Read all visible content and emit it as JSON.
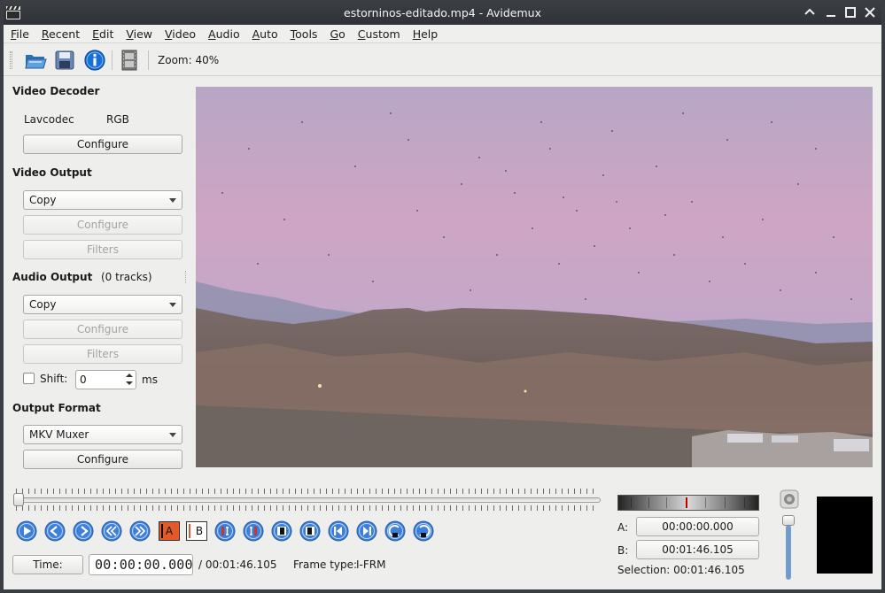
{
  "window": {
    "title": "estorninos-editado.mp4 - Avidemux"
  },
  "menu": [
    "File",
    "Recent",
    "Edit",
    "View",
    "Video",
    "Audio",
    "Auto",
    "Tools",
    "Go",
    "Custom",
    "Help"
  ],
  "toolbar": {
    "zoom": "Zoom: 40%",
    "icons": [
      "open-icon",
      "save-icon",
      "info-icon",
      "filmstrip-icon"
    ]
  },
  "panel": {
    "video_decoder": {
      "heading": "Video Decoder",
      "codec": "Lavcodec",
      "format": "RGB",
      "configure": "Configure"
    },
    "video_output": {
      "heading": "Video Output",
      "selected": "Copy",
      "configure": "Configure",
      "filters": "Filters"
    },
    "audio_output": {
      "heading": "Audio Output",
      "tracks": "(0 tracks)",
      "selected": "Copy",
      "configure": "Configure",
      "filters": "Filters",
      "shift_label": "Shift:",
      "shift_value": "0",
      "shift_unit": "ms"
    },
    "output_format": {
      "heading": "Output Format",
      "selected": "MKV Muxer",
      "configure": "Configure"
    }
  },
  "navigation": {
    "buttons": [
      "play-icon",
      "previous-frame-icon",
      "next-frame-icon",
      "previous-keyframe-icon",
      "next-keyframe-icon",
      "set-marker-a-icon",
      "set-marker-b-icon",
      "previous-black-frame-icon",
      "next-black-frame-icon",
      "go-first-frame-icon",
      "go-last-frame-icon",
      "go-marker-a-icon",
      "go-marker-b-icon",
      "previous-cut-icon",
      "next-cut-icon"
    ],
    "marker_a_label": "A",
    "marker_b_label": "B"
  },
  "status": {
    "time_button": "Time:",
    "current_time": "00:00:00.000",
    "total_time": "/ 00:01:46.105",
    "frame_type_label": "Frame type:",
    "frame_type": "I-FRM"
  },
  "markers": {
    "a_label": "A:",
    "a_value": "00:00:00.000",
    "b_label": "B:",
    "b_value": "00:01:46.105",
    "selection": "Selection: 00:01:46.105"
  },
  "playback": {
    "position_fraction": 0.0,
    "volume_fraction": 1.0
  },
  "colors": {
    "accent": "#3d7fd9",
    "titlebar": "#34373b",
    "jog_marker": "#c00000"
  }
}
